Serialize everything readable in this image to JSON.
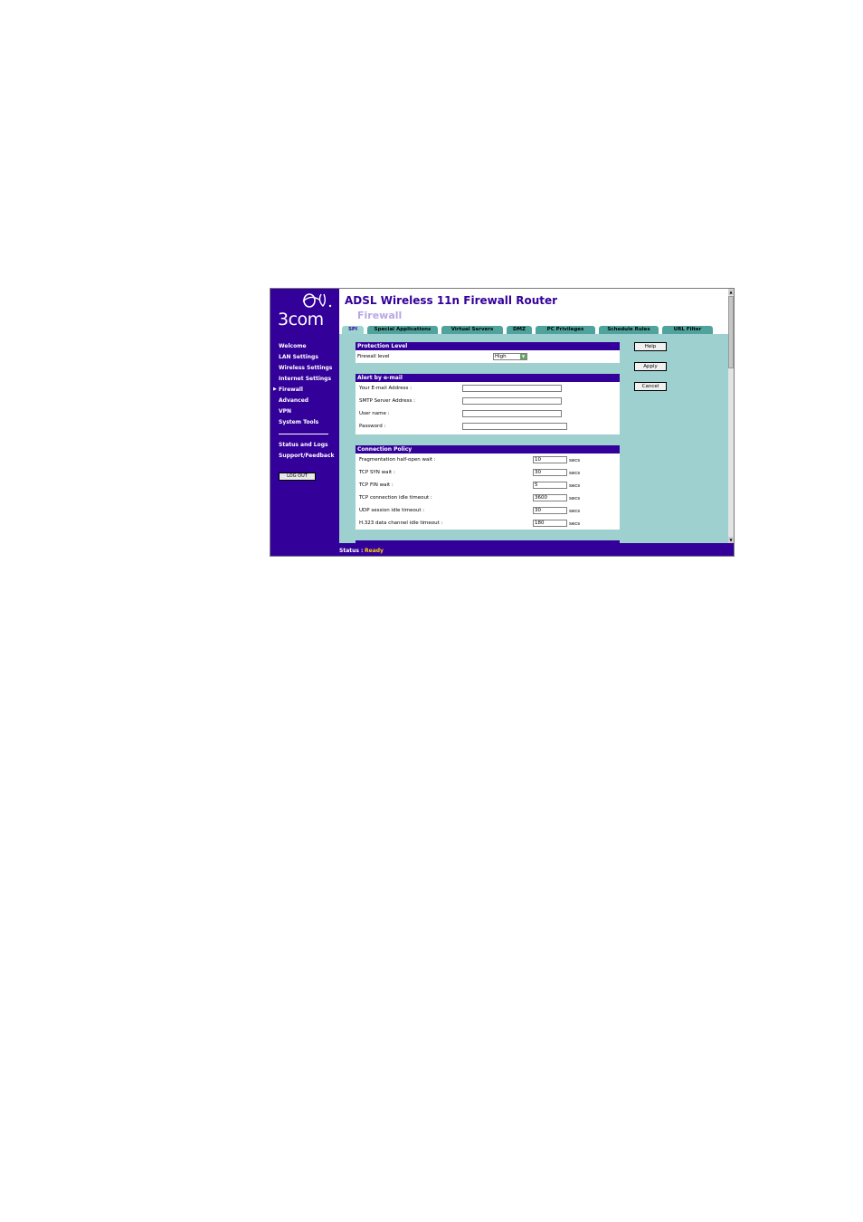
{
  "brand": {
    "logo_text": "3com"
  },
  "header": {
    "app_title": "ADSL Wireless 11n Firewall Router",
    "page_title": "Firewall"
  },
  "tabs": [
    {
      "label": "SPI"
    },
    {
      "label": "Special Applications"
    },
    {
      "label": "Virtual Servers"
    },
    {
      "label": "DMZ"
    },
    {
      "label": "PC Privileges"
    },
    {
      "label": "Schedule Rules"
    },
    {
      "label": "URL Filter"
    }
  ],
  "sidebar": {
    "items": [
      {
        "label": "Welcome"
      },
      {
        "label": "LAN Settings"
      },
      {
        "label": "Wireless Settings"
      },
      {
        "label": "Internet Settings"
      },
      {
        "label": "Firewall"
      },
      {
        "label": "Advanced"
      },
      {
        "label": "VPN"
      },
      {
        "label": "System Tools"
      },
      {
        "label": "Status and Logs"
      },
      {
        "label": "Support/Feedback"
      }
    ],
    "logout_label": "LOG OUT"
  },
  "protection": {
    "heading": "Protection Level",
    "firewall_level_label": "Firewall level",
    "firewall_level_value": "High"
  },
  "alert": {
    "heading": "Alert by e-mail",
    "email_label": "Your E-mail Address :",
    "smtp_label": "SMTP Server Address :",
    "username_label": "User name :",
    "password_label": "Password :",
    "email_value": "",
    "smtp_value": "",
    "username_value": "",
    "password_value": ""
  },
  "policy": {
    "heading": "Connection Policy",
    "unit": "secs",
    "rows": [
      {
        "label": "Fragmentation half-open wait :",
        "value": "10"
      },
      {
        "label": "TCP SYN wait :",
        "value": "30"
      },
      {
        "label": "TCP FIN wait :",
        "value": "5"
      },
      {
        "label": "TCP connection idle timeout :",
        "value": "3600"
      },
      {
        "label": "UDP session idle timeout :",
        "value": "30"
      },
      {
        "label": "H.323 data channel idle timeout :",
        "value": "180"
      }
    ]
  },
  "actions": {
    "help": "Help",
    "apply": "Apply",
    "cancel": "Cancel"
  },
  "status": {
    "label": "Status :",
    "value": "Ready"
  },
  "colors": {
    "nav": "#33009a",
    "content": "#9ed0cf",
    "tab": "#4fa39c",
    "status_value": "#ffd400"
  }
}
